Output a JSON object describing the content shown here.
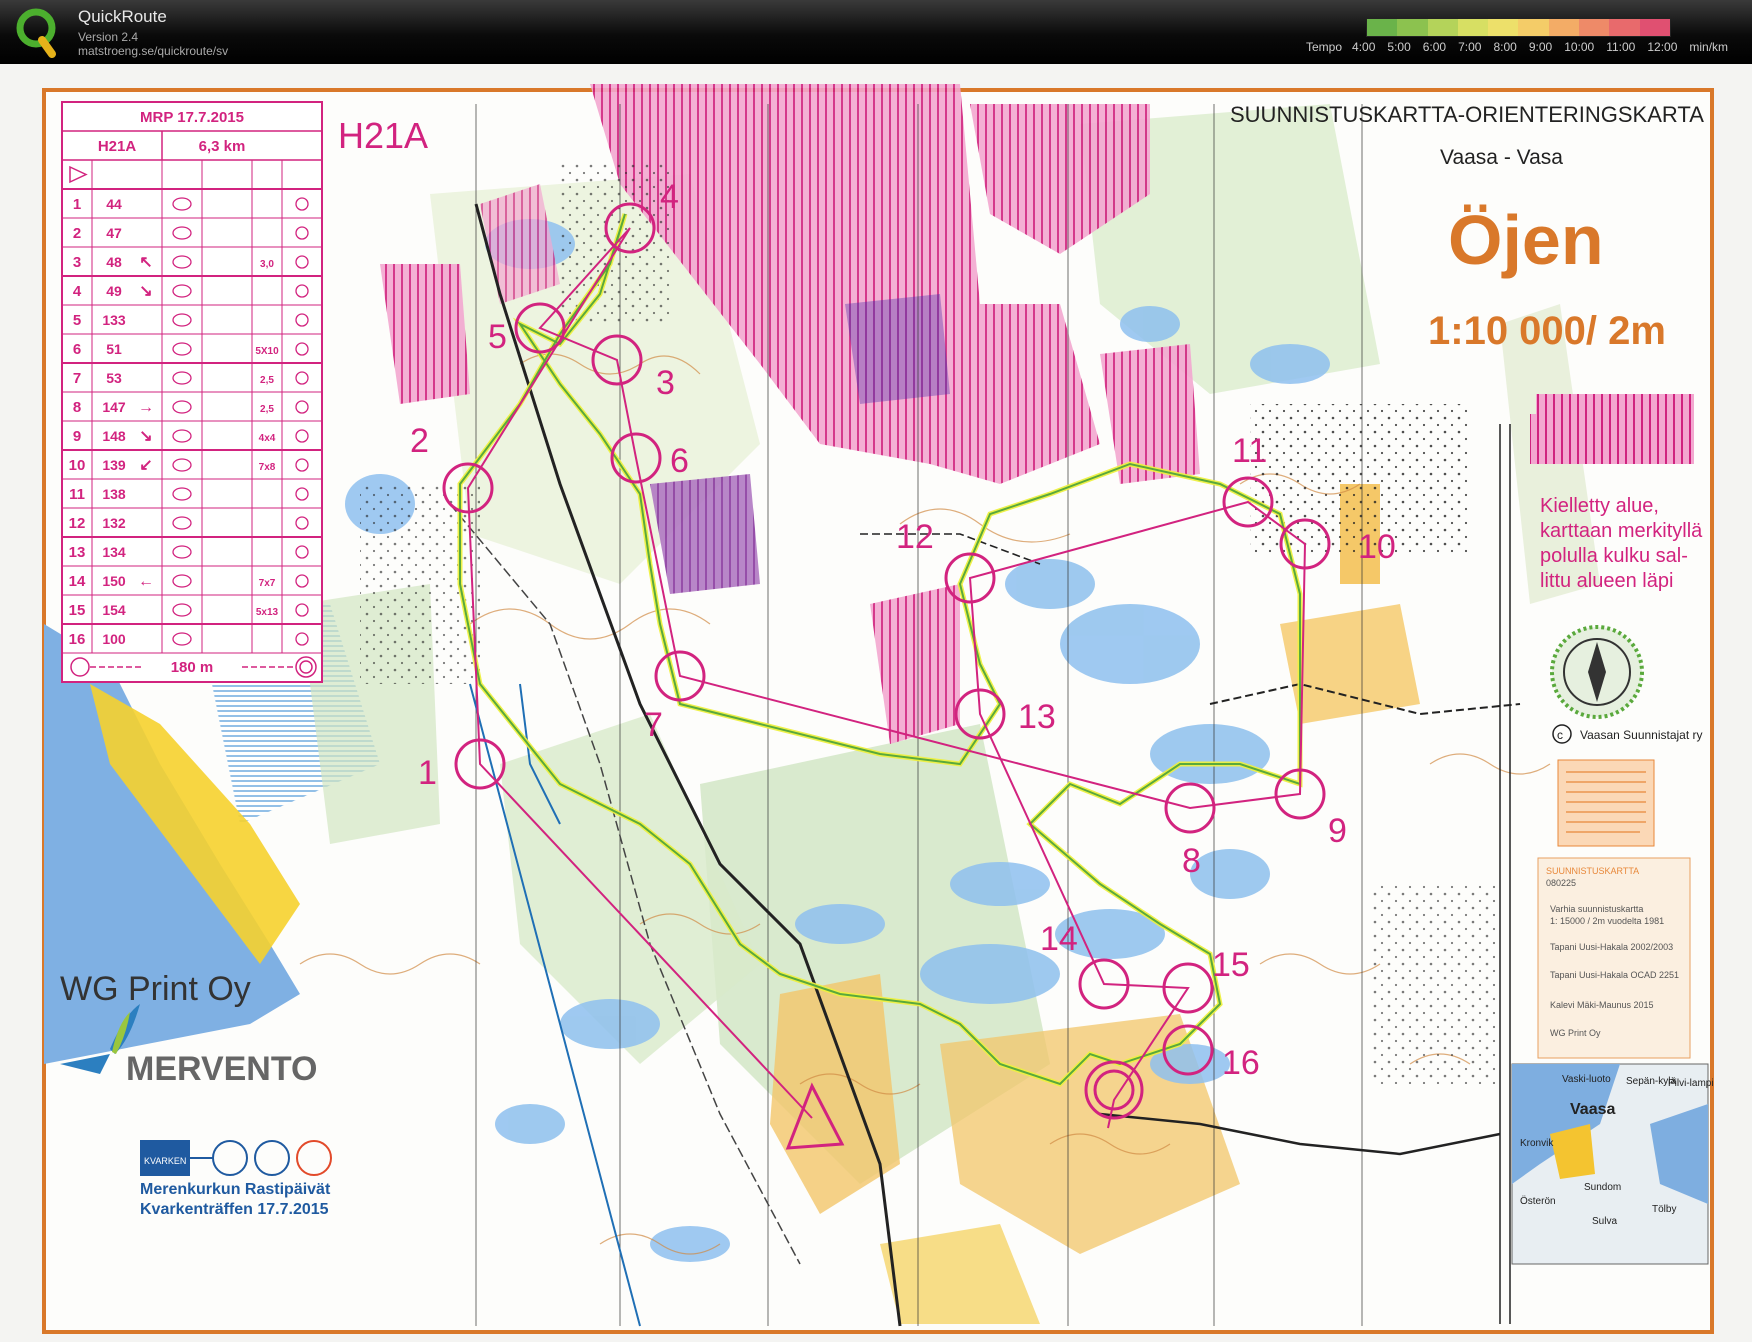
{
  "app": {
    "title": "QuickRoute",
    "version": "Version 2.4",
    "url": "matstroeng.se/quickroute/sv"
  },
  "tempo": {
    "label": "Tempo",
    "ticks": [
      "4:00",
      "5:00",
      "6:00",
      "7:00",
      "8:00",
      "9:00",
      "10:00",
      "11:00",
      "12:00"
    ],
    "unit": "min/km",
    "gradient_colors": [
      "#6ab34a",
      "#8cc24f",
      "#b4d35a",
      "#d7df63",
      "#ede06a",
      "#f4cc68",
      "#f3ac66",
      "#ee8a68",
      "#e86a6c",
      "#e05071"
    ]
  },
  "map": {
    "header": "SUUNNISTUSKARTTA-ORIENTERINGSKARTA",
    "location": "Vaasa - Vasa",
    "name": "Öjen",
    "scale": "1:10 000/ 2m",
    "class_label": "H21A",
    "forbidden_note": [
      "Kielletty alue,",
      "karttaan merkityllä",
      "polulla kulku sal-",
      "littu alueen läpi"
    ],
    "copyright": "Vaasan Suunnistajat ry",
    "sponsors": [
      "WG Print Oy",
      "MERVENTO"
    ],
    "event": [
      "Merenkurkun Rastipäivät",
      "Kvarkenträffen  17.7.2015"
    ],
    "kvarken_logo": "KVARKEN",
    "info_box": [
      "SUUNNISTUSKARTTA",
      "080225",
      "Varhia suunnistuskartta",
      "1: 15000 / 2m vuodelta 1981",
      "Tapani Uusi-Hakala 2002/2003",
      "Tapani Uusi-Hakala OCAD 2251",
      "Kalevi Mäki-Maunus 2015",
      "WG Print Oy"
    ],
    "inset_places": [
      "Vaski-luoto",
      "Vaasa",
      "Sepän-kylä",
      "Pilvi-lampi",
      "Kronvik",
      "Sundom",
      "Tölby",
      "Sulva",
      "Österön"
    ],
    "control_labels": [
      "1",
      "2",
      "3",
      "4",
      "5",
      "6",
      "7",
      "8",
      "9",
      "10",
      "11",
      "12",
      "13",
      "14",
      "15",
      "16"
    ]
  },
  "description_sheet": {
    "event": "MRP 17.7.2015",
    "class": "H21A",
    "length": "6,3 km",
    "rows": [
      {
        "n": "1",
        "code": "44",
        "d": "",
        "dim": ""
      },
      {
        "n": "2",
        "code": "47",
        "d": "",
        "dim": ""
      },
      {
        "n": "3",
        "code": "48",
        "d": "↖",
        "dim": "3,0"
      },
      {
        "n": "4",
        "code": "49",
        "d": "↘",
        "dim": ""
      },
      {
        "n": "5",
        "code": "133",
        "d": "",
        "dim": ""
      },
      {
        "n": "6",
        "code": "51",
        "d": "",
        "dim": "5X10"
      },
      {
        "n": "7",
        "code": "53",
        "d": "",
        "dim": "2,5"
      },
      {
        "n": "8",
        "code": "147",
        "d": "→",
        "dim": "2,5"
      },
      {
        "n": "9",
        "code": "148",
        "d": "↘",
        "dim": "4x4"
      },
      {
        "n": "10",
        "code": "139",
        "d": "↙",
        "dim": "7x8"
      },
      {
        "n": "11",
        "code": "138",
        "d": "",
        "dim": ""
      },
      {
        "n": "12",
        "code": "132",
        "d": "",
        "dim": ""
      },
      {
        "n": "13",
        "code": "134",
        "d": "",
        "dim": ""
      },
      {
        "n": "14",
        "code": "150",
        "d": "←",
        "dim": "7x7"
      },
      {
        "n": "15",
        "code": "154",
        "d": "",
        "dim": "5x13"
      },
      {
        "n": "16",
        "code": "100",
        "d": "",
        "dim": ""
      }
    ],
    "finish": "180 m"
  }
}
